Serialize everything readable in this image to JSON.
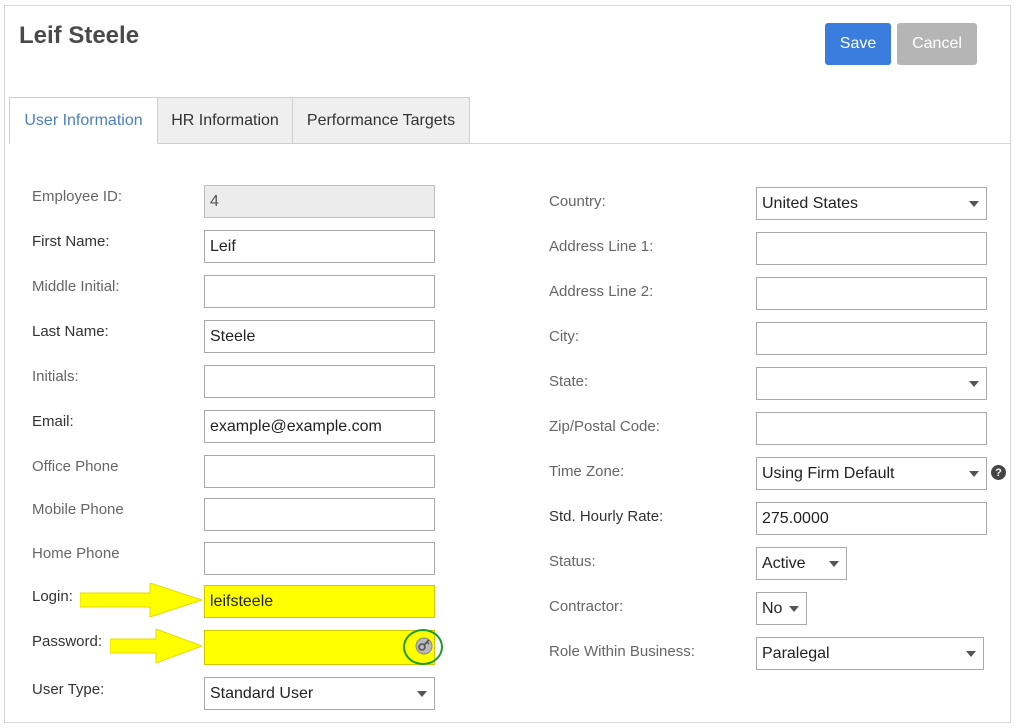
{
  "header": {
    "title": "Leif Steele",
    "save_label": "Save",
    "cancel_label": "Cancel"
  },
  "tabs": [
    {
      "label": "User Information",
      "active": true
    },
    {
      "label": "HR Information",
      "active": false
    },
    {
      "label": "Performance Targets",
      "active": false
    }
  ],
  "left_form": {
    "employee_id": {
      "label": "Employee ID:",
      "value": "4"
    },
    "first_name": {
      "label": "First Name:",
      "value": "Leif"
    },
    "middle_initial": {
      "label": "Middle Initial:",
      "value": ""
    },
    "last_name": {
      "label": "Last Name:",
      "value": "Steele"
    },
    "initials": {
      "label": "Initials:",
      "value": ""
    },
    "email": {
      "label": "Email:",
      "value": "example@example.com"
    },
    "office_phone": {
      "label": "Office Phone",
      "value": ""
    },
    "mobile_phone": {
      "label": "Mobile Phone",
      "value": ""
    },
    "home_phone": {
      "label": "Home Phone",
      "value": ""
    },
    "login": {
      "label": "Login:",
      "value": "leifsteele"
    },
    "password": {
      "label": "Password:",
      "value": ""
    },
    "user_type": {
      "label": "User Type:",
      "value": "Standard User"
    }
  },
  "right_form": {
    "country": {
      "label": "Country:",
      "value": "United States"
    },
    "address1": {
      "label": "Address Line 1:",
      "value": ""
    },
    "address2": {
      "label": "Address Line 2:",
      "value": ""
    },
    "city": {
      "label": "City:",
      "value": ""
    },
    "state": {
      "label": "State:",
      "value": ""
    },
    "zip": {
      "label": "Zip/Postal Code:",
      "value": ""
    },
    "time_zone": {
      "label": "Time Zone:",
      "value": "Using Firm Default"
    },
    "hourly_rate": {
      "label": "Std. Hourly Rate:",
      "value": "275.0000"
    },
    "status": {
      "label": "Status:",
      "value": "Active"
    },
    "contractor": {
      "label": "Contractor:",
      "value": "No"
    },
    "role": {
      "label": "Role Within Business:",
      "value": "Paralegal"
    }
  },
  "icons": {
    "help": "question-circle-icon",
    "key": "key-icon",
    "arrow": "arrow-right-icon"
  },
  "colors": {
    "accent": "#3b7dde",
    "highlight": "#ffff00",
    "ring": "#1a9a2a"
  }
}
